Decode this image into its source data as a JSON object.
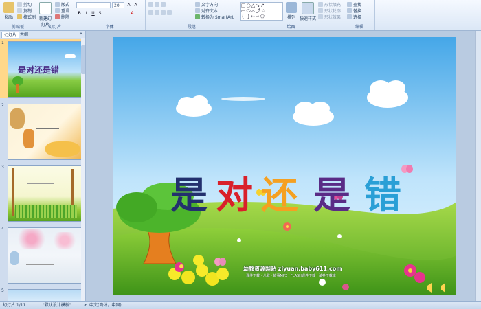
{
  "ribbon": {
    "clipboard": {
      "label": "剪贴板",
      "paste": "粘贴",
      "cut": "剪切",
      "copy": "复制",
      "format_painter": "格式刷"
    },
    "slides": {
      "label": "幻灯片",
      "new_slide": "新建幻灯片",
      "layout": "版式",
      "reset": "重设",
      "delete": "删除"
    },
    "font": {
      "label": "字体",
      "font_size": "20"
    },
    "paragraph": {
      "label": "段落",
      "text_direction": "文字方向",
      "align_text": "对齐文本",
      "smartart": "转换为 SmartArt"
    },
    "drawing": {
      "label": "绘图",
      "arrange": "排列",
      "quick_styles": "快速样式",
      "shape_fill": "形状填充",
      "shape_outline": "形状轮廓",
      "shape_effects": "形状效果"
    },
    "editing": {
      "label": "编辑",
      "find": "查找",
      "replace": "替换",
      "select": "选择"
    }
  },
  "panel": {
    "tab_slides": "幻灯片",
    "tab_outline": "大纲",
    "close": "×",
    "thumbs": [
      {
        "num": "1",
        "title": "是对还是错"
      },
      {
        "num": "2",
        "title": ""
      },
      {
        "num": "3",
        "title": ""
      },
      {
        "num": "4",
        "title": ""
      },
      {
        "num": "5",
        "title": ""
      }
    ]
  },
  "slide": {
    "title_chars": [
      {
        "ch": "是",
        "color": "#23306e"
      },
      {
        "ch": "对",
        "color": "#d9202a"
      },
      {
        "ch": "还",
        "color": "#f5a021"
      },
      {
        "ch": "是",
        "color": "#5a2b86"
      },
      {
        "ch": "错",
        "color": "#2a9fd6"
      }
    ],
    "site": "幼教资源网站 ziyuan.baby611.com",
    "subline": "课件下载 · 儿歌 · 故事MP3 · FLASH课件下载 · 试卷下载库"
  },
  "status": {
    "slide_info": "幻灯片 1/11",
    "theme": "\"默认设计模板\"",
    "language": "中文(简体，中国)"
  }
}
